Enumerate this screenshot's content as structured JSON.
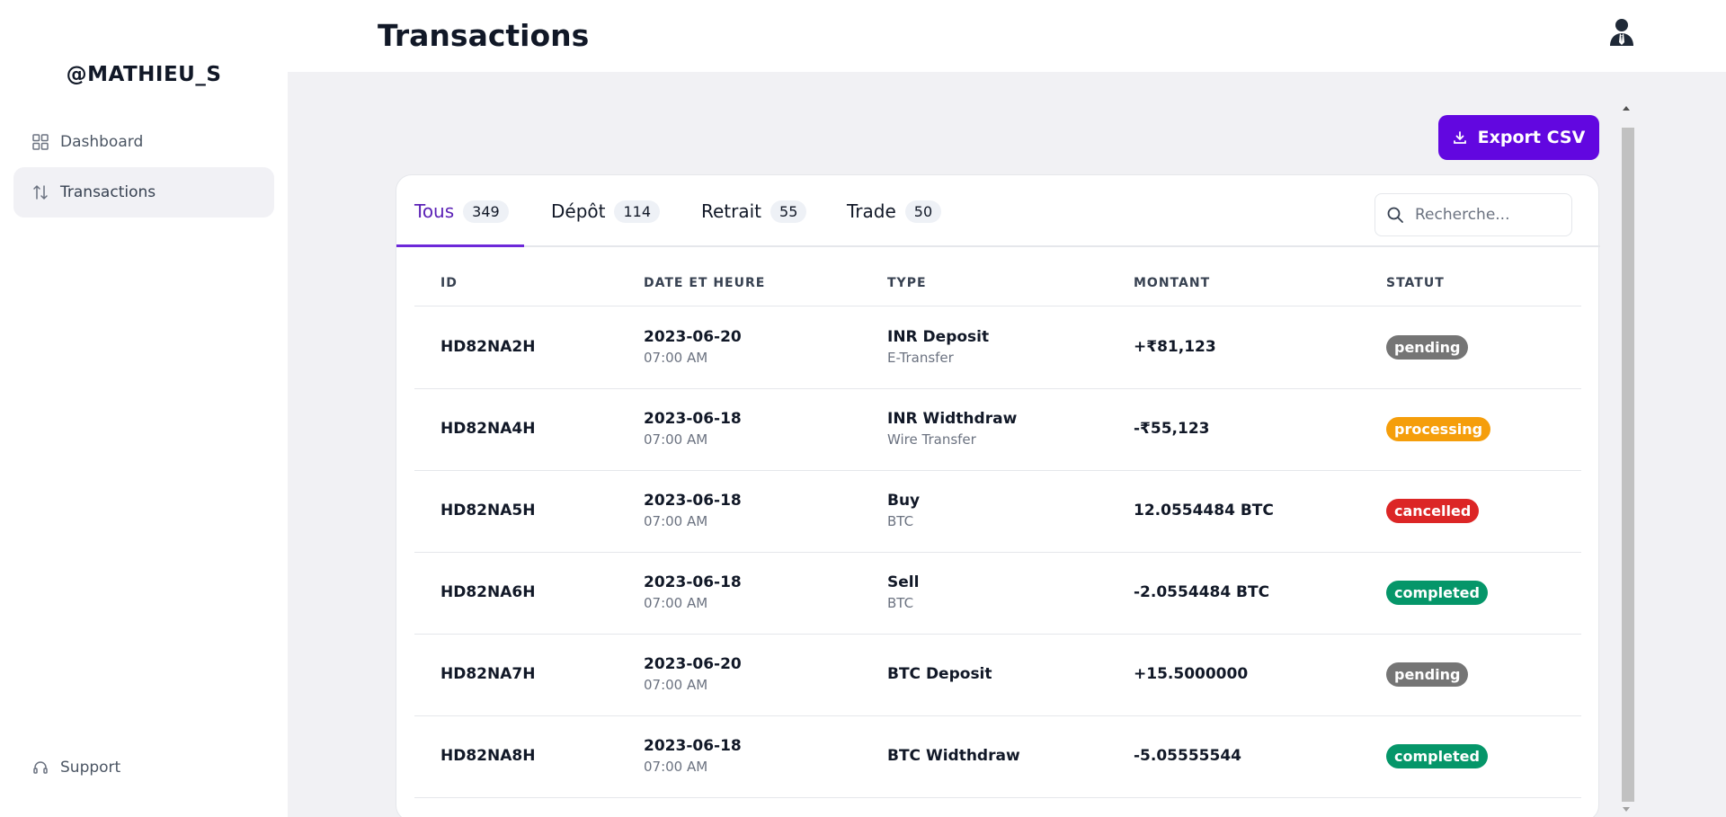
{
  "sidebar": {
    "username": "@MATHIEU_S",
    "items": [
      {
        "label": "Dashboard",
        "icon": "grid-icon"
      },
      {
        "label": "Transactions",
        "icon": "arrows-updown-icon"
      }
    ],
    "support_label": "Support"
  },
  "header": {
    "title": "Transactions",
    "user_icon": "user-icon"
  },
  "toolbar": {
    "export_label": "Export CSV"
  },
  "tabs": [
    {
      "label": "Tous",
      "count": "349"
    },
    {
      "label": "Dépôt",
      "count": "114"
    },
    {
      "label": "Retrait",
      "count": "55"
    },
    {
      "label": "Trade",
      "count": "50"
    }
  ],
  "search": {
    "placeholder": "Recherche..."
  },
  "table": {
    "columns": [
      "ID",
      "DATE ET HEURE",
      "TYPE",
      "MONTANT",
      "STATUT"
    ],
    "rows": [
      {
        "id": "HD82NA2H",
        "date": "2023-06-20",
        "time": "07:00 AM",
        "type": "INR Deposit",
        "subtype": "E-Transfer",
        "amount": "+₹81,123",
        "status": "pending"
      },
      {
        "id": "HD82NA4H",
        "date": "2023-06-18",
        "time": "07:00 AM",
        "type": "INR Widthdraw",
        "subtype": "Wire Transfer",
        "amount": "-₹55,123",
        "status": "processing"
      },
      {
        "id": "HD82NA5H",
        "date": "2023-06-18",
        "time": "07:00 AM",
        "type": "Buy",
        "subtype": "BTC",
        "amount": "12.0554484 BTC",
        "status": "cancelled"
      },
      {
        "id": "HD82NA6H",
        "date": "2023-06-18",
        "time": "07:00 AM",
        "type": "Sell",
        "subtype": "BTC",
        "amount": "-2.0554484 BTC",
        "status": "completed"
      },
      {
        "id": "HD82NA7H",
        "date": "2023-06-20",
        "time": "07:00 AM",
        "type": "BTC Deposit",
        "subtype": "",
        "amount": "+15.5000000",
        "status": "pending"
      },
      {
        "id": "HD82NA8H",
        "date": "2023-06-18",
        "time": "07:00 AM",
        "type": "BTC Widthdraw",
        "subtype": "",
        "amount": "-5.05555544",
        "status": "completed"
      }
    ]
  },
  "colors": {
    "accent": "#6207e0",
    "pending": "#757575",
    "processing": "#f59e0b",
    "cancelled": "#dc2626",
    "completed": "#059669"
  }
}
